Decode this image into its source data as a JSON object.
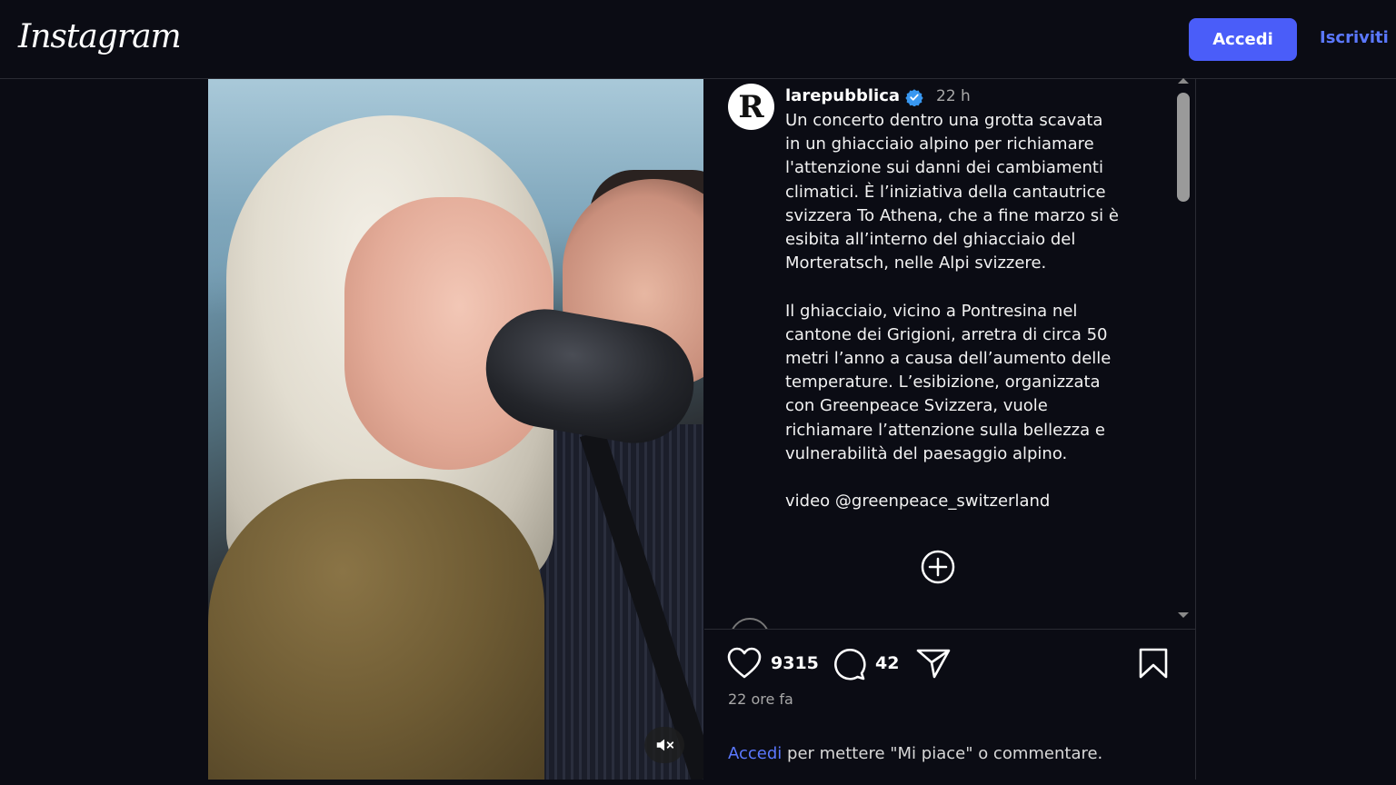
{
  "header": {
    "logo": "Instagram",
    "login_label": "Accedi",
    "signup_label": "Iscriviti"
  },
  "post": {
    "username": "larepubblica",
    "avatar_letter": "R",
    "time_short": "22 h",
    "caption": "Un concerto dentro una grotta scavata\nin un ghiacciaio alpino per richiamare\nl'attenzione sui danni dei cambiamenti\nclimatici. È l’iniziativa della cantautrice\nsvizzera To Athena, che a fine marzo si è\nesibita all’interno del ghiacciaio del\nMorteratsch, nelle Alpi svizzere.\n\nIl ghiacciaio, vicino a Pontresina nel\ncantone dei Grigioni, arretra di circa 50\nmetri l’anno a causa dell’aumento delle\ntemperature. L’esibizione, organizzata\ncon Greenpeace Svizzera, vuole\nrichiamare l’attenzione sulla bellezza e\nvulnerabilità del paesaggio alpino.\n\nvideo @greenpeace_switzerland",
    "likes": "9315",
    "comments": "42",
    "posted": "22 ore fa"
  },
  "footer": {
    "login_link": "Accedi",
    "login_text": " per mettere \"Mi piace\" o commentare."
  },
  "colors": {
    "background": "#0b0c14",
    "accent": "#4a5df9",
    "link": "#5b78ff",
    "verified": "#3897f0"
  },
  "icons": [
    "heart-icon",
    "comment-icon",
    "share-icon",
    "bookmark-icon",
    "plus-circle-icon",
    "muted-speaker-icon",
    "verified-badge-icon"
  ]
}
